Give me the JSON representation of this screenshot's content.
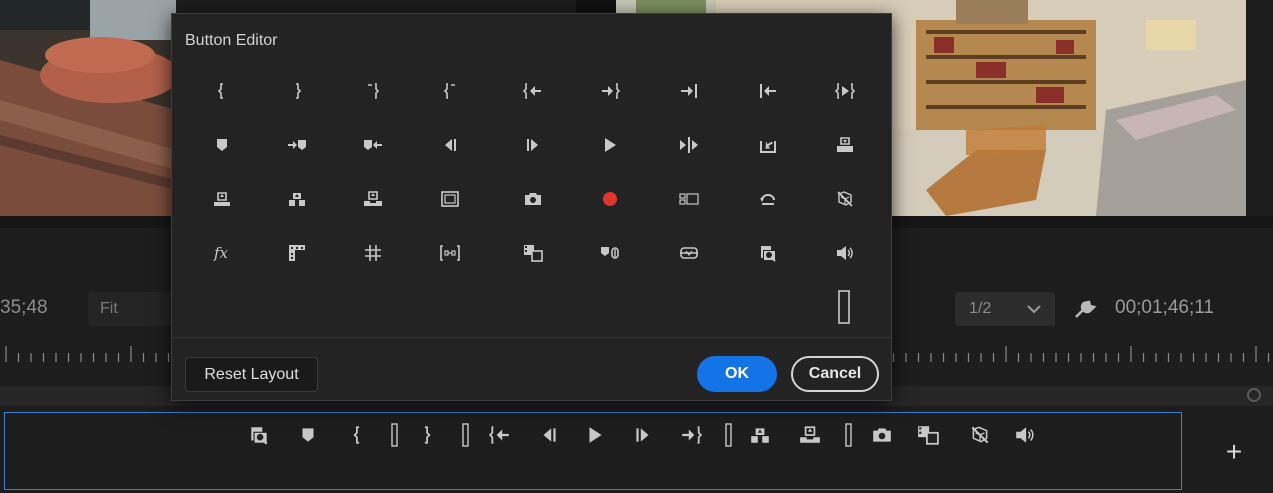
{
  "program_monitor": {
    "timecode_left": "35;48",
    "fit_select": "Fit",
    "resolution_select": "1/2",
    "timecode_right": "00;01;46;11"
  },
  "button_bar": {
    "buttons": [
      "export-frame-icon",
      "add-marker-icon",
      "mark-in-icon",
      "spacer",
      "mark-out-icon",
      "spacer",
      "go-to-in-icon",
      "step-back-icon",
      "play-icon",
      "step-forward-icon",
      "go-to-out-icon",
      "spacer",
      "lift-icon",
      "extract-icon",
      "spacer",
      "camera-icon",
      "comparison-view-icon",
      "proxy-toggle-icon",
      "volume-icon"
    ],
    "add_label": "+"
  },
  "dialog": {
    "title": "Button Editor",
    "icons": [
      [
        "mark-in-icon",
        "mark-out-icon",
        "clear-in-icon",
        "clear-out-icon",
        "go-to-in-icon",
        "go-to-out-icon",
        "go-to-next-edit-icon",
        "go-to-prev-edit-icon",
        "play-in-to-out-icon"
      ],
      [
        "add-marker-icon",
        "go-to-next-marker-icon",
        "go-to-prev-marker-icon",
        "step-back-icon",
        "step-forward-icon",
        "play-icon",
        "play-around-icon",
        "insert-icon",
        "overwrite-icon"
      ],
      [
        "lift-up-icon",
        "lift-icon",
        "extract-icon",
        "safe-margins-icon",
        "camera-icon",
        "record-icon",
        "multicam-icon",
        "loop-icon",
        "proxy-toggle-icon"
      ],
      [
        "fx-icon",
        "vr-video-icon",
        "grid-icon",
        "trim-icon",
        "comparison-view-icon",
        "lock-link-icon",
        "global-fx-mute-icon",
        "export-frame-icon",
        "volume-icon"
      ],
      [
        "spacer-icon"
      ]
    ],
    "fx_label": "fx",
    "record_color": "#e0352b",
    "reset_label": "Reset Layout",
    "ok_label": "OK",
    "cancel_label": "Cancel"
  },
  "colors": {
    "accent": "#1473e6",
    "bar_border": "#3c7fcf"
  }
}
